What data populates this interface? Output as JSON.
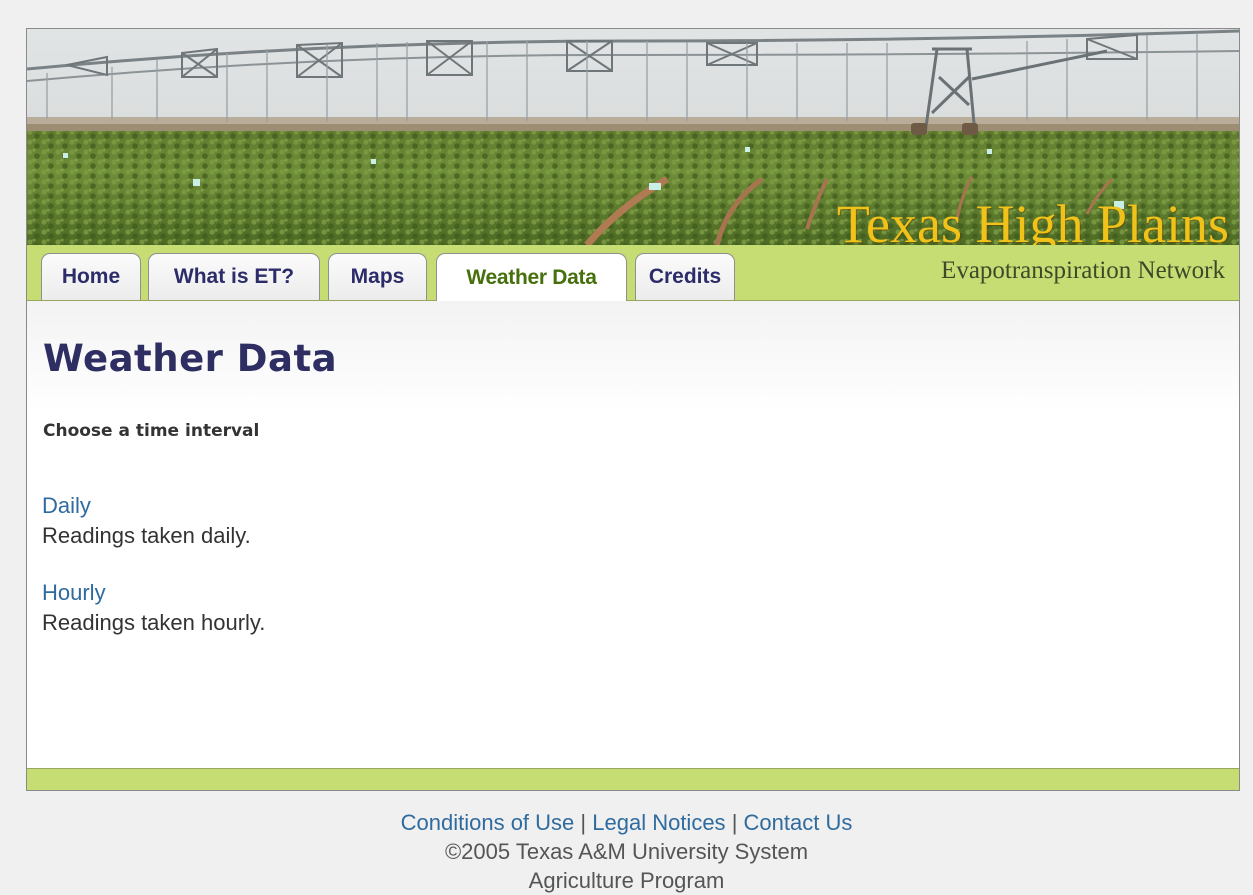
{
  "header": {
    "title": "Texas High Plains",
    "subtitle": "Evapotranspiration Network"
  },
  "nav": {
    "tabs": [
      {
        "label": "Home",
        "active": false
      },
      {
        "label": "What is ET?",
        "active": false
      },
      {
        "label": "Maps",
        "active": false
      },
      {
        "label": "Weather Data",
        "active": true
      },
      {
        "label": "Credits",
        "active": false
      }
    ]
  },
  "main": {
    "page_title": "Weather Data",
    "section_label": "Choose a time interval",
    "intervals": [
      {
        "link": "Daily",
        "description": "Readings taken daily."
      },
      {
        "link": "Hourly",
        "description": "Readings taken hourly."
      }
    ]
  },
  "footer": {
    "links": [
      "Conditions of Use",
      "Legal Notices",
      "Contact Us"
    ],
    "separator": "|",
    "copyright": "©2005 Texas A&M University System",
    "program": "Agriculture Program"
  },
  "colors": {
    "accent_green": "#c6dd73",
    "title_gold": "#f1c219",
    "heading_navy": "#2e2e62",
    "link_blue": "#2f6b9e",
    "active_tab_green": "#46700c"
  }
}
